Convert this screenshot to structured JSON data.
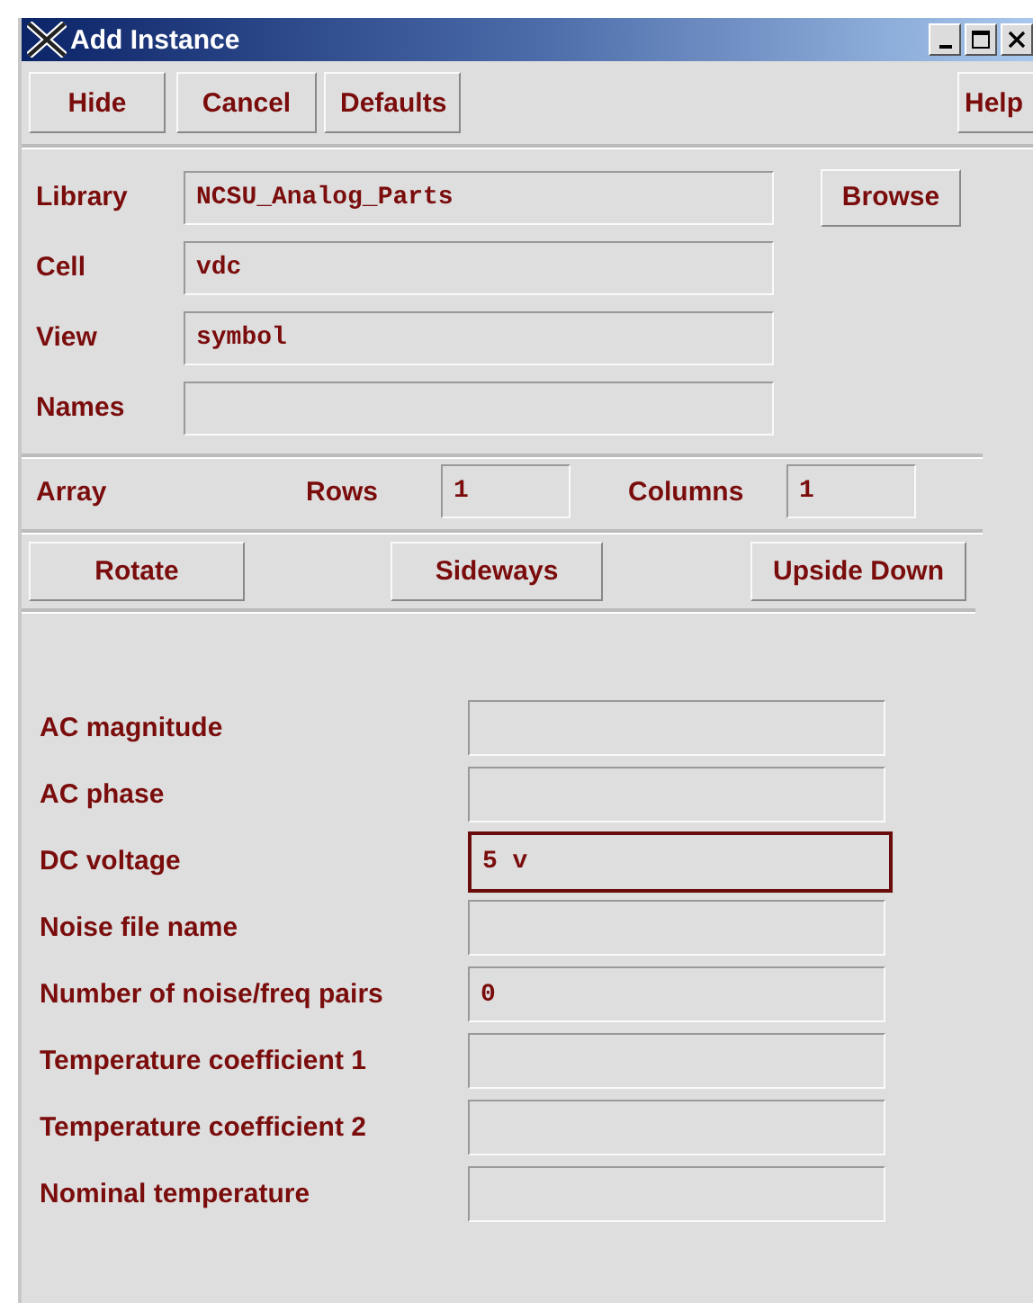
{
  "window": {
    "title": "Add Instance"
  },
  "toolbar": {
    "left": [
      "Hide",
      "Cancel",
      "Defaults"
    ],
    "right": "Help"
  },
  "library": {
    "label": "Library",
    "value": "NCSU_Analog_Parts",
    "button": "Browse"
  },
  "fields": [
    {
      "label": "Cell",
      "value": "vdc"
    },
    {
      "label": "View",
      "value": "symbol"
    },
    {
      "label": "Names"
    }
  ],
  "array": {
    "label": "Array",
    "rows_label": "Rows",
    "rows": "1",
    "columns_label": "Columns",
    "columns": "1"
  },
  "orientation_buttons": [
    "Rotate",
    "Sideways",
    "Upside Down"
  ],
  "parameters": [
    {
      "label": "AC magnitude",
      "focused": false
    },
    {
      "label": "AC phase",
      "focused": false
    },
    {
      "label": "DC voltage",
      "value": "5 v",
      "focused": true
    },
    {
      "label": "Noise file name",
      "focused": false
    },
    {
      "label": "Number of noise/freq pairs",
      "value": "0",
      "focused": false
    },
    {
      "label": "Temperature coefficient 1",
      "focused": false
    },
    {
      "label": "Temperature coefficient 2",
      "focused": false
    },
    {
      "label": "Nominal temperature",
      "focused": false
    }
  ]
}
